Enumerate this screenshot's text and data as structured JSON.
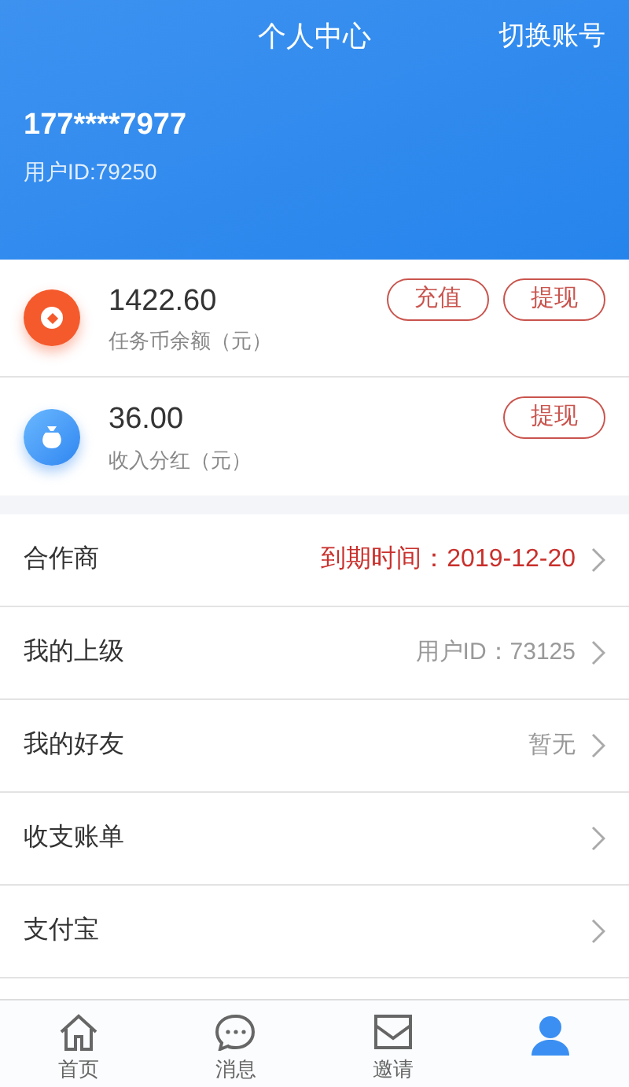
{
  "header": {
    "title": "个人中心",
    "switch_account": "切换账号",
    "phone": "177****7977",
    "user_id": "用户ID:79250"
  },
  "balances": [
    {
      "kind": "coin",
      "amount": "1422.60",
      "label": "任务币余额（元）",
      "buttons": [
        "充值",
        "提现"
      ]
    },
    {
      "kind": "bag",
      "amount": "36.00",
      "label": "收入分红（元）",
      "buttons": [
        "提现"
      ]
    }
  ],
  "menu": [
    {
      "label": "合作商",
      "value": "到期时间：2019-12-20",
      "kind": "alert"
    },
    {
      "label": "我的上级",
      "value": "用户ID：73125",
      "kind": "detail"
    },
    {
      "label": "我的好友",
      "value": "暂无",
      "kind": "detail"
    },
    {
      "label": "收支账单",
      "kind": "link"
    },
    {
      "label": "支付宝",
      "kind": "link"
    }
  ],
  "tabs": [
    {
      "kind": "home",
      "label": "首页",
      "selected": false
    },
    {
      "kind": "message",
      "label": "消息",
      "selected": false
    },
    {
      "kind": "invite",
      "label": "邀请",
      "selected": false
    },
    {
      "kind": "user",
      "selected": true
    }
  ]
}
